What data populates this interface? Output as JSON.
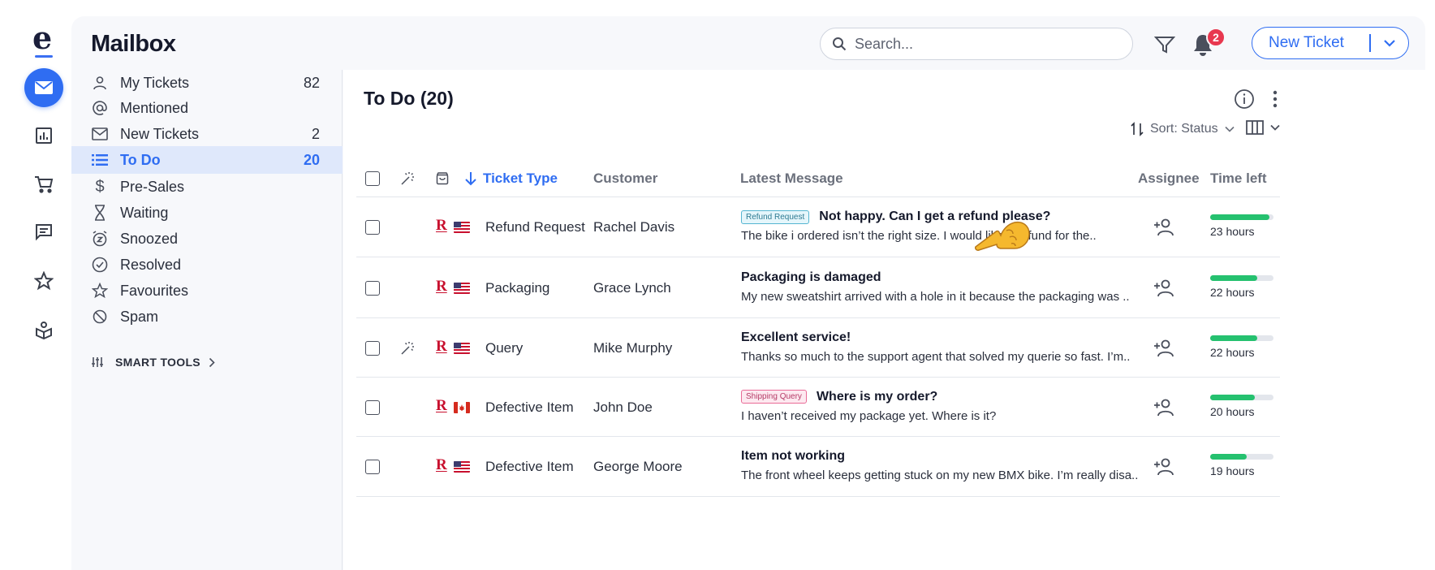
{
  "app": {
    "title": "Mailbox"
  },
  "header": {
    "search_placeholder": "Search...",
    "notification_count": "2",
    "new_ticket_label": "New Ticket"
  },
  "rail": [
    "mail-icon",
    "reports-icon",
    "cart-icon",
    "chat-icon",
    "star-icon",
    "knowledge-icon"
  ],
  "sidebar": {
    "items": [
      {
        "label": "My Tickets",
        "count": "82",
        "icon": "user-icon"
      },
      {
        "label": "Mentioned",
        "count": "",
        "icon": "at-icon"
      },
      {
        "label": "New Tickets",
        "count": "2",
        "icon": "envelope-icon"
      },
      {
        "label": "To Do",
        "count": "20",
        "icon": "list-icon",
        "active": true
      },
      {
        "label": "Pre-Sales",
        "count": "",
        "icon": "dollar-icon"
      },
      {
        "label": "Waiting",
        "count": "",
        "icon": "hourglass-icon"
      },
      {
        "label": "Snoozed",
        "count": "",
        "icon": "snooze-icon"
      },
      {
        "label": "Resolved",
        "count": "",
        "icon": "check-circle-icon"
      },
      {
        "label": "Favourites",
        "count": "",
        "icon": "star-icon"
      },
      {
        "label": "Spam",
        "count": "",
        "icon": "block-icon"
      }
    ],
    "smart_tools_label": "SMART TOOLS"
  },
  "main": {
    "list_title": "To Do (20)",
    "sort_label": "Sort: Status",
    "columns": {
      "ticket_type": "Ticket Type",
      "customer": "Customer",
      "latest_message": "Latest Message",
      "assignee": "Assignee",
      "time_left": "Time left"
    },
    "rows": [
      {
        "magic": false,
        "flag": "us",
        "type": "Refund Request",
        "customer": "Rachel Davis",
        "tag": "Refund Request",
        "tag_kind": "refund",
        "subject": "Not happy. Can I get a refund please?",
        "body": "The bike i ordered isn’t the right size. I would like a refund for the..",
        "time_left": "23 hours",
        "time_fraction": 0.94
      },
      {
        "magic": false,
        "flag": "us",
        "type": "Packaging",
        "customer": "Grace Lynch",
        "tag": "",
        "tag_kind": "",
        "subject": "Packaging is damaged",
        "body": "My new sweatshirt arrived with a hole in it because the packaging was ..",
        "time_left": "22 hours",
        "time_fraction": 0.74
      },
      {
        "magic": true,
        "flag": "us",
        "type": "Query",
        "customer": "Mike Murphy",
        "tag": "",
        "tag_kind": "",
        "subject": "Excellent service!",
        "body": "Thanks so much to the support agent that solved my querie so fast. I’m..",
        "time_left": "22 hours",
        "time_fraction": 0.74
      },
      {
        "magic": false,
        "flag": "ca",
        "type": "Defective Item",
        "customer": "John Doe",
        "tag": "Shipping Query",
        "tag_kind": "ship",
        "subject": "Where is my order?",
        "body": "I haven’t received my package yet. Where is it?",
        "time_left": "20 hours",
        "time_fraction": 0.71
      },
      {
        "magic": false,
        "flag": "us",
        "type": "Defective Item",
        "customer": "George Moore",
        "tag": "",
        "tag_kind": "",
        "subject": "Item not working",
        "body": "The front wheel keeps getting stuck on my new BMX bike. I’m really disa..",
        "time_left": "19 hours",
        "time_fraction": 0.58
      }
    ]
  },
  "colors": {
    "accent": "#2f6df2",
    "progress": "#25c16f",
    "badge": "#e8384f",
    "active_nav": "#dfe8fb"
  }
}
